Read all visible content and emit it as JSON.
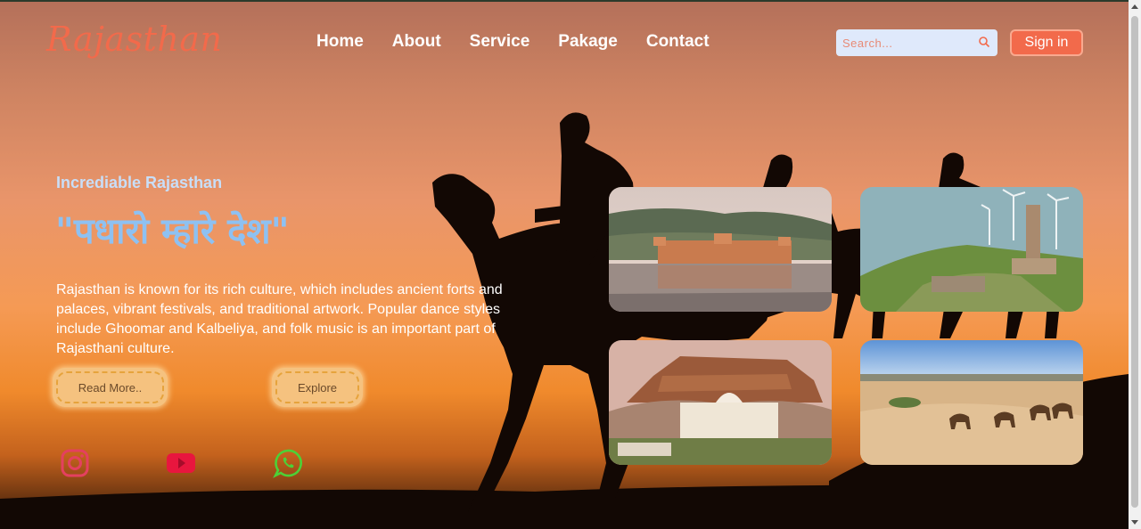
{
  "brand": {
    "logo_text": "Rajasthan",
    "accent_color": "#f26a4b"
  },
  "nav": {
    "items": [
      "Home",
      "About",
      "Service",
      "Pakage",
      "Contact"
    ]
  },
  "search": {
    "placeholder": "Search..."
  },
  "signin": {
    "label": "Sign in"
  },
  "hero": {
    "kicker": "Incrediable Rajasthan",
    "headline": "\"पधारो म्हारे देश\"",
    "description": "Rajasthan is known for its rich culture, which includes ancient forts and palaces, vibrant festivals, and traditional artwork. Popular dance styles include Ghoomar and Kalbeliya, and folk music is an important part of Rajasthani culture.",
    "buttons": {
      "read_more": "Read More..",
      "explore": "Explore"
    }
  },
  "social": [
    {
      "name": "instagram-icon",
      "color": "#e4405f"
    },
    {
      "name": "youtube-icon",
      "color": "#e8163e"
    },
    {
      "name": "whatsapp-icon",
      "color": "#4cd137"
    }
  ],
  "gallery": [
    {
      "name": "jal-mahal-image"
    },
    {
      "name": "hill-fort-windmills-image"
    },
    {
      "name": "mehrangarh-fort-image"
    },
    {
      "name": "desert-camels-image"
    }
  ]
}
